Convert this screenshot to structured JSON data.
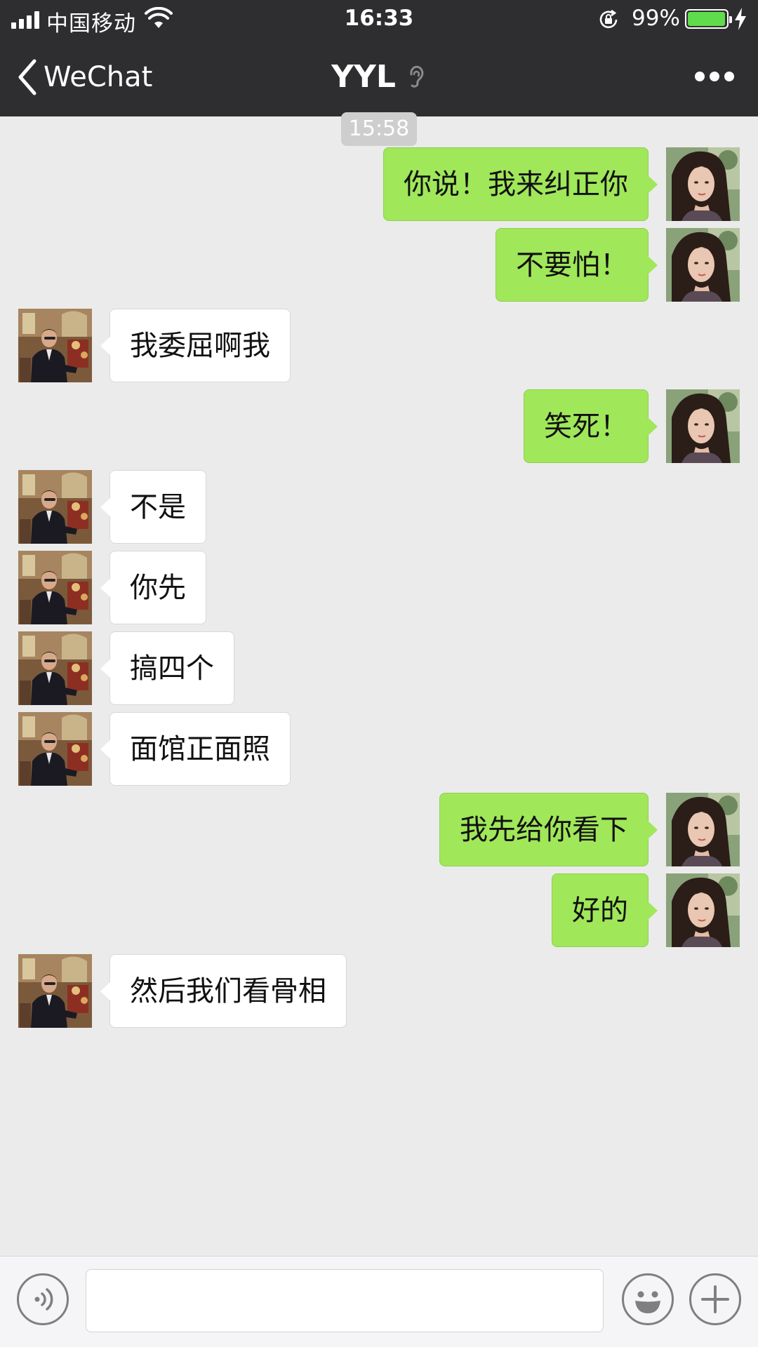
{
  "status_bar": {
    "carrier": "中国移动",
    "time": "16:33",
    "battery_percent": "99%",
    "battery_level": 0.99,
    "battery_color": "#5fdc4b"
  },
  "nav": {
    "back_label": "WeChat",
    "title": "YYL"
  },
  "timestamp": "15:58",
  "messages": [
    {
      "side": "out",
      "text": "你说！我来纠正你"
    },
    {
      "side": "out",
      "text": "不要怕！"
    },
    {
      "side": "in",
      "text": "我委屈啊我"
    },
    {
      "side": "out",
      "text": "笑死！"
    },
    {
      "side": "in",
      "text": "不是"
    },
    {
      "side": "in",
      "text": "你先"
    },
    {
      "side": "in",
      "text": "搞四个"
    },
    {
      "side": "in",
      "text": "面馆正面照"
    },
    {
      "side": "out",
      "text": "我先给你看下"
    },
    {
      "side": "out",
      "text": "好的"
    },
    {
      "side": "in",
      "text": "然后我们看骨相"
    }
  ],
  "input": {
    "value": "",
    "placeholder": ""
  },
  "colors": {
    "outgoing_bubble": "#a0e75a",
    "incoming_bubble": "#ffffff",
    "chat_background": "#ebebeb",
    "header": "#2e2e30"
  },
  "icons": {
    "back": "chevron-left-icon",
    "ear": "ear-icon",
    "more": "more-dots-icon",
    "voice": "voice-icon",
    "emoji": "emoji-icon",
    "plus": "plus-icon"
  }
}
